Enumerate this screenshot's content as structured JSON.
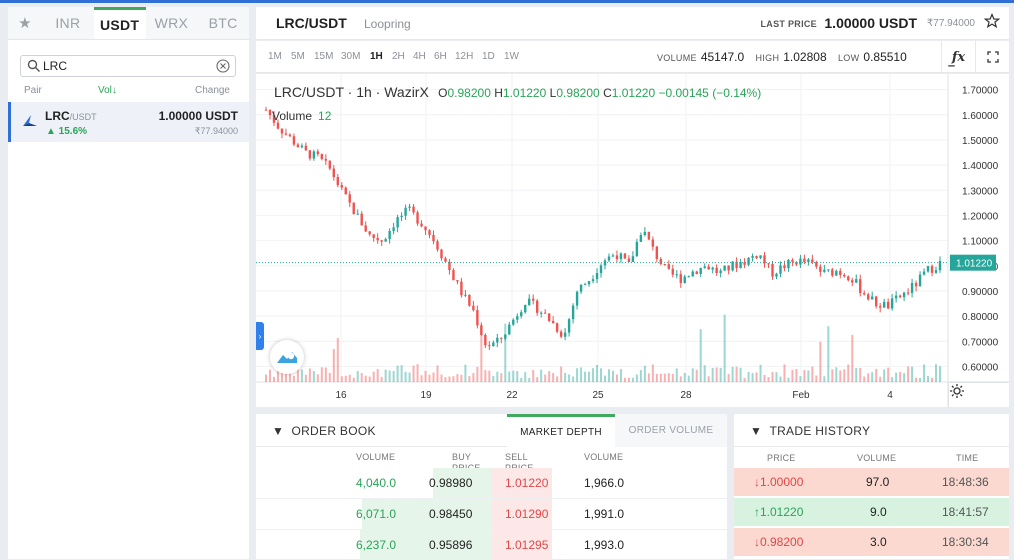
{
  "market_panel": {
    "tabs": [
      "INR",
      "USDT",
      "WRX",
      "BTC"
    ],
    "active_tab": "USDT",
    "search": {
      "value": "LRC",
      "placeholder": ""
    },
    "columns": {
      "pair": "Pair",
      "vol": "Vol↓",
      "change": "Change"
    },
    "rows": [
      {
        "base": "LRC",
        "quote": "/USDT",
        "change": "▲ 15.6%",
        "price": "1.00000 USDT",
        "inr": "₹77.94000"
      }
    ]
  },
  "header": {
    "title": "LRC/USDT",
    "exchange": "Loopring",
    "last_price_label": "LAST PRICE",
    "last_price": "1.00000 USDT",
    "last_price_inr": "₹77.94000"
  },
  "toolbar": {
    "timeframes": [
      "1M",
      "5M",
      "15M",
      "30M",
      "1H",
      "2H",
      "4H",
      "6H",
      "12H",
      "1D",
      "1W"
    ],
    "active_timeframe": "1H",
    "volume_label": "VOLUME",
    "volume": "45147.0",
    "high_label": "HIGH",
    "high": "1.02808",
    "low_label": "LOW",
    "low": "0.85510",
    "fx_label": "f̲x"
  },
  "chart_legend": {
    "symbol": "LRC/USDT · 1h · WazirX",
    "o_label": "O",
    "o": "0.98200",
    "h_label": "H",
    "h": "1.01220",
    "l_label": "L",
    "l": "0.98200",
    "c_label": "C",
    "c": "1.01220",
    "change": "−0.00145 (−0.14%)",
    "volume_label": "Volume",
    "volume": "12"
  },
  "chart_data": {
    "type": "candlestick",
    "y_ticks": [
      "1.70000",
      "1.60000",
      "1.50000",
      "1.40000",
      "1.30000",
      "1.20000",
      "1.10000",
      "1.00000",
      "0.90000",
      "0.80000",
      "0.70000",
      "0.60000"
    ],
    "y_values": [
      1.7,
      1.6,
      1.5,
      1.4,
      1.3,
      1.2,
      1.1,
      1.0,
      0.9,
      0.8,
      0.7,
      0.6
    ],
    "ylim": [
      0.55,
      1.75
    ],
    "x_ticks": [
      "16",
      "19",
      "22",
      "25",
      "28",
      "Feb",
      "4"
    ],
    "last_price_tag": "1.01220",
    "last_price_value": 1.0122,
    "close_path": [
      1.62,
      1.55,
      1.5,
      1.45,
      1.43,
      1.38,
      1.28,
      1.2,
      1.12,
      1.1,
      1.18,
      1.22,
      1.17,
      1.1,
      1.0,
      0.9,
      0.82,
      0.68,
      0.7,
      0.78,
      0.86,
      0.83,
      0.78,
      0.72,
      0.9,
      0.95,
      1.02,
      1.05,
      1.0,
      1.15,
      1.05,
      0.97,
      0.95,
      0.98,
      1.0,
      0.97,
      1.0,
      1.02,
      1.05,
      0.97,
      1.0,
      1.02,
      1.01,
      0.97,
      0.98,
      0.96,
      0.9,
      0.85,
      0.84,
      0.88,
      0.92,
      0.98,
      1.01
    ],
    "grid": true,
    "colors": {
      "up": "#26a69a",
      "down": "#ef5350"
    }
  },
  "order_book": {
    "title": "ORDER BOOK",
    "tabs": [
      "MARKET DEPTH",
      "ORDER VOLUME"
    ],
    "active_tab": "MARKET DEPTH",
    "columns": {
      "volume_buy": "VOLUME",
      "buy_price": "BUY PRICE",
      "sell_price": "SELL PRICE",
      "volume_sell": "VOLUME"
    },
    "rows": [
      {
        "buy_volume": "4,040.0",
        "buy_price": "0.98980",
        "sell_price": "1.01220",
        "sell_volume": "1,966.0",
        "buy_depth": 0.25,
        "sell_depth": 0.3
      },
      {
        "buy_volume": "6,071.0",
        "buy_price": "0.98450",
        "sell_price": "1.01290",
        "sell_volume": "1,991.0",
        "buy_depth": 0.55,
        "sell_depth": 0.3
      },
      {
        "buy_volume": "6,237.0",
        "buy_price": "0.95896",
        "sell_price": "1.01295",
        "sell_volume": "1,993.0",
        "buy_depth": 0.56,
        "sell_depth": 0.3
      }
    ]
  },
  "trade_history": {
    "title": "TRADE HISTORY",
    "columns": {
      "price": "PRICE",
      "volume": "VOLUME",
      "time": "TIME"
    },
    "rows": [
      {
        "side": "sell",
        "price": "↓1.00000",
        "volume": "97.0",
        "time": "18:48:36"
      },
      {
        "side": "buy",
        "price": "↑1.01220",
        "volume": "9.0",
        "time": "18:41:57"
      },
      {
        "side": "sell",
        "price": "↓0.98200",
        "volume": "3.0",
        "time": "18:30:34"
      }
    ]
  }
}
